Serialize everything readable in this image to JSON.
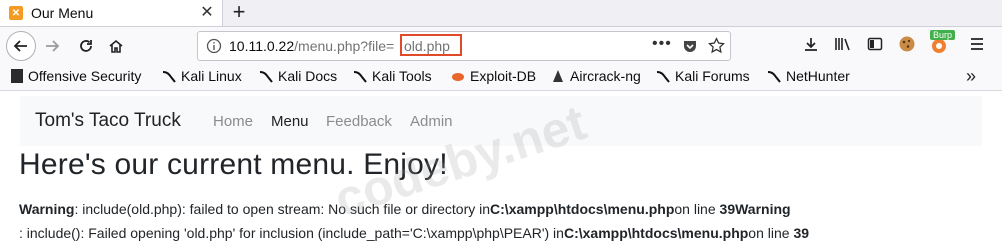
{
  "tab": {
    "title": "Our Menu",
    "close": "✕",
    "new_tab": "+"
  },
  "nav": {
    "url_host": "10.11.0.22",
    "url_path": "/menu.php?file=",
    "url_param": "old.php",
    "highlight_color": "#e04a2b",
    "icons": [
      "back-icon",
      "forward-icon",
      "reload-icon",
      "home-icon",
      "info-icon",
      "page-actions-icon",
      "pocket-icon",
      "bookmark-star-icon",
      "download-icon",
      "library-icon",
      "sidebar-icon",
      "cookie-icon",
      "burp-icon",
      "menu-icon"
    ],
    "burp_badge": "Burp"
  },
  "bookmarks": [
    {
      "label": "Offensive Security",
      "icon": "offsec-icon"
    },
    {
      "label": "Kali Linux",
      "icon": "kali-icon"
    },
    {
      "label": "Kali Docs",
      "icon": "kali-icon"
    },
    {
      "label": "Kali Tools",
      "icon": "kali-icon"
    },
    {
      "label": "Exploit-DB",
      "icon": "exploitdb-icon"
    },
    {
      "label": "Aircrack-ng",
      "icon": "aircrack-icon"
    },
    {
      "label": "Kali Forums",
      "icon": "kali-icon"
    },
    {
      "label": "NetHunter",
      "icon": "kali-icon"
    }
  ],
  "site": {
    "brand": "Tom's Taco Truck",
    "links": [
      {
        "label": "Home",
        "active": false
      },
      {
        "label": "Menu",
        "active": true
      },
      {
        "label": "Feedback",
        "active": false
      },
      {
        "label": "Admin",
        "active": false
      }
    ],
    "heading": "Here's our current menu. Enjoy!",
    "warning1": {
      "label": "Warning",
      "text": ": include(old.php): failed to open stream: No such file or directory in",
      "path": "C:\\xampp\\htdocs\\menu.php",
      "on": "on line",
      "line": "39",
      "trail": "Warning"
    },
    "warning2": {
      "text": ": include(): Failed opening 'old.php' for inclusion (include_path='C:\\xampp\\php\\PEAR') in",
      "path": "C:\\xampp\\htdocs\\menu.php",
      "on": "on line",
      "line": "39"
    }
  },
  "watermark": "codeby.net"
}
